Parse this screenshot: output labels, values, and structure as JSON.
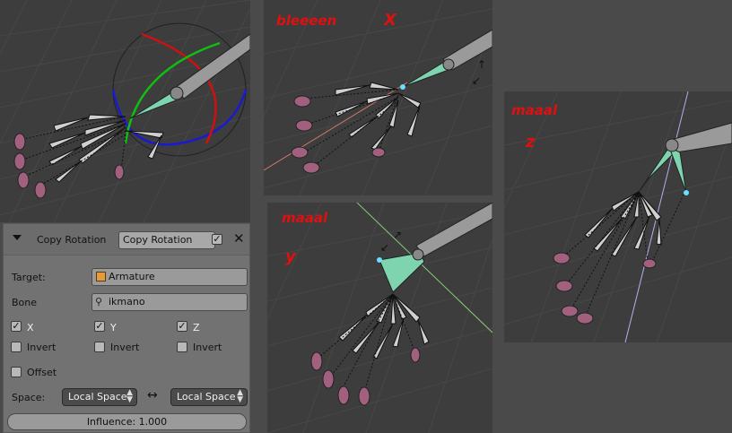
{
  "viewports": {
    "x": {
      "label1": "bleeeen",
      "label2": "X"
    },
    "y": {
      "label1": "maaal",
      "label2": "y"
    },
    "z": {
      "label1": "maaal",
      "label2": "z"
    }
  },
  "constraint_panel": {
    "type_label": "Copy Rotation",
    "name_value": "Copy Rotation",
    "target_label": "Target:",
    "target_value": "Armature",
    "bone_label": "Bone",
    "bone_value": "ikmano",
    "axes": [
      {
        "axis": "X",
        "enabled": true,
        "invert_label": "Invert",
        "invert": false
      },
      {
        "axis": "Y",
        "enabled": true,
        "invert_label": "Invert",
        "invert": false
      },
      {
        "axis": "Z",
        "enabled": true,
        "invert_label": "Invert",
        "invert": false
      }
    ],
    "offset_label": "Offset",
    "offset": false,
    "space_label": "Space:",
    "owner_space": "Local Space",
    "target_space": "Local Space",
    "swap_icon": "swap-arrows-icon",
    "influence_label": "Influence: 1.000",
    "influence": 1.0
  },
  "colors": {
    "annotation": "#e01010",
    "viewport_bg": "#3d3d3d",
    "panel_bg": "#727272",
    "bone_selected": "#7fd4b0",
    "fingertip": "#a0607e",
    "gizmo_x": "#d01010",
    "gizmo_y": "#10c010",
    "gizmo_z": "#1010d0"
  }
}
